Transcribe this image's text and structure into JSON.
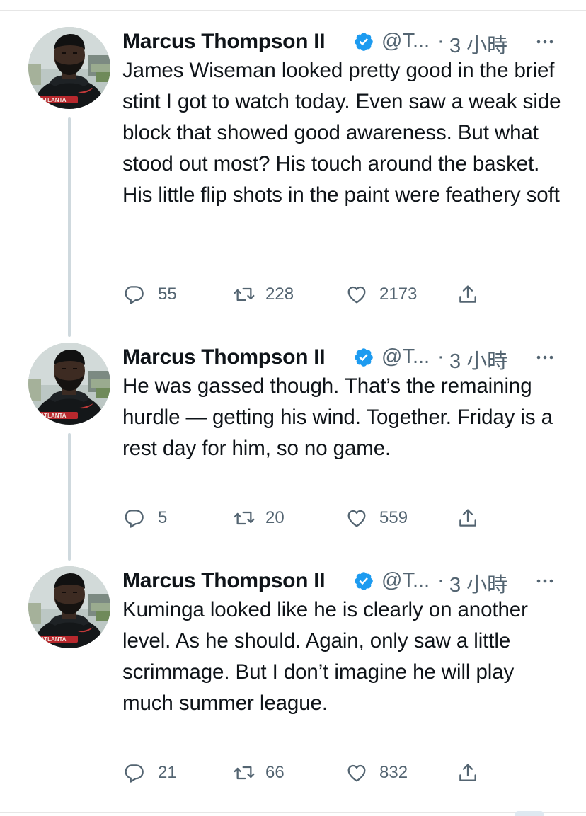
{
  "tweets": [
    {
      "author": "Marcus Thompson II",
      "handle": "@T...",
      "separator": "·",
      "time": "3 小時",
      "text": "James Wiseman looked pretty good in the brief stint I got to watch today. Even saw a weak side block that showed good awareness. But what stood out most? His touch around the basket. His little flip shots in the paint were feathery soft",
      "replies": "55",
      "retweets": "228",
      "likes": "2173"
    },
    {
      "author": "Marcus Thompson II",
      "handle": "@T...",
      "separator": "·",
      "time": "3 小時",
      "text": "He was gassed though. That’s the remaining hurdle — getting his wind. Together. Friday is a rest day for him, so no game.",
      "replies": "5",
      "retweets": "20",
      "likes": "559"
    },
    {
      "author": "Marcus Thompson II",
      "handle": "@T...",
      "separator": "·",
      "time": "3 小時",
      "text": "Kuminga looked like he is clearly on another level. As he should. Again, only saw a little scrimmage. But I don’t imagine he will play much summer league.",
      "replies": "21",
      "retweets": "66",
      "likes": "832"
    }
  ],
  "colors": {
    "text": "#0f1419",
    "secondary": "#536471",
    "verified": "#1d9bf0",
    "thread_line": "#cfd9de",
    "divider": "#e6e6e6"
  },
  "icons": {
    "verified": "verified-badge-icon",
    "more": "more-options-icon",
    "reply": "reply-icon",
    "retweet": "retweet-icon",
    "like": "heart-icon",
    "share": "share-icon"
  }
}
